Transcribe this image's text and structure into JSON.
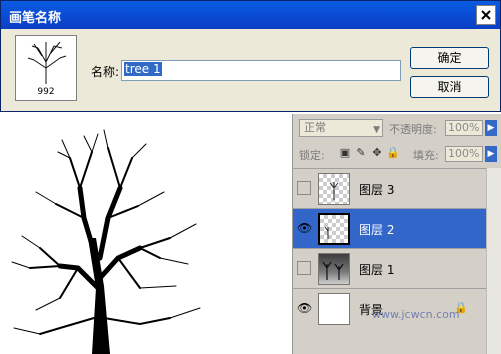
{
  "dialog": {
    "title": "画笔名称",
    "brush_count": "992",
    "name_label": "名称:",
    "name_value": "tree 1",
    "ok_label": "确定",
    "cancel_label": "取消"
  },
  "layers_panel": {
    "blend_mode": "正常",
    "opacity_label": "不透明度:",
    "opacity_value": "100%",
    "lock_label": "锁定:",
    "fill_label": "填充:",
    "fill_value": "100%",
    "layers": [
      {
        "name": "图层 3",
        "visible": false,
        "active": false
      },
      {
        "name": "图层 2",
        "visible": true,
        "active": true
      },
      {
        "name": "图层 1",
        "visible": false,
        "active": false
      },
      {
        "name": "背景",
        "visible": true,
        "active": false,
        "locked": true
      }
    ]
  },
  "watermark": "www.jcwcn.com",
  "colors": {
    "titlebar": "#0b4fd6",
    "selection": "#316ac5",
    "active_layer": "#3266c9"
  }
}
